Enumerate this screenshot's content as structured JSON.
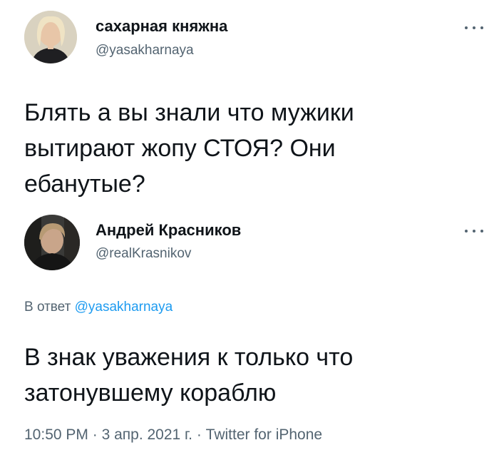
{
  "tweet1": {
    "display_name": "сахарная княжна",
    "handle": "@yasakharnaya",
    "more_icon": "more-horizontal-icon",
    "text": "Блять а вы знали что мужики\nвытирают жопу СТОЯ? Они\nебанутые?"
  },
  "tweet2": {
    "display_name": "Андрей Красников",
    "handle": "@realKrasnikov",
    "more_icon": "more-horizontal-icon",
    "reply_prefix": "В ответ",
    "reply_mention": "@yasakharnaya",
    "text": "В знак уважения к только что\nзатонувшему кораблю",
    "time": "10:50 PM",
    "separator": "·",
    "date": "3 апр. 2021 г.",
    "source": "Twitter for iPhone"
  },
  "colors": {
    "text": "#0f1419",
    "secondary": "#536471",
    "link": "#1d9bf0"
  }
}
